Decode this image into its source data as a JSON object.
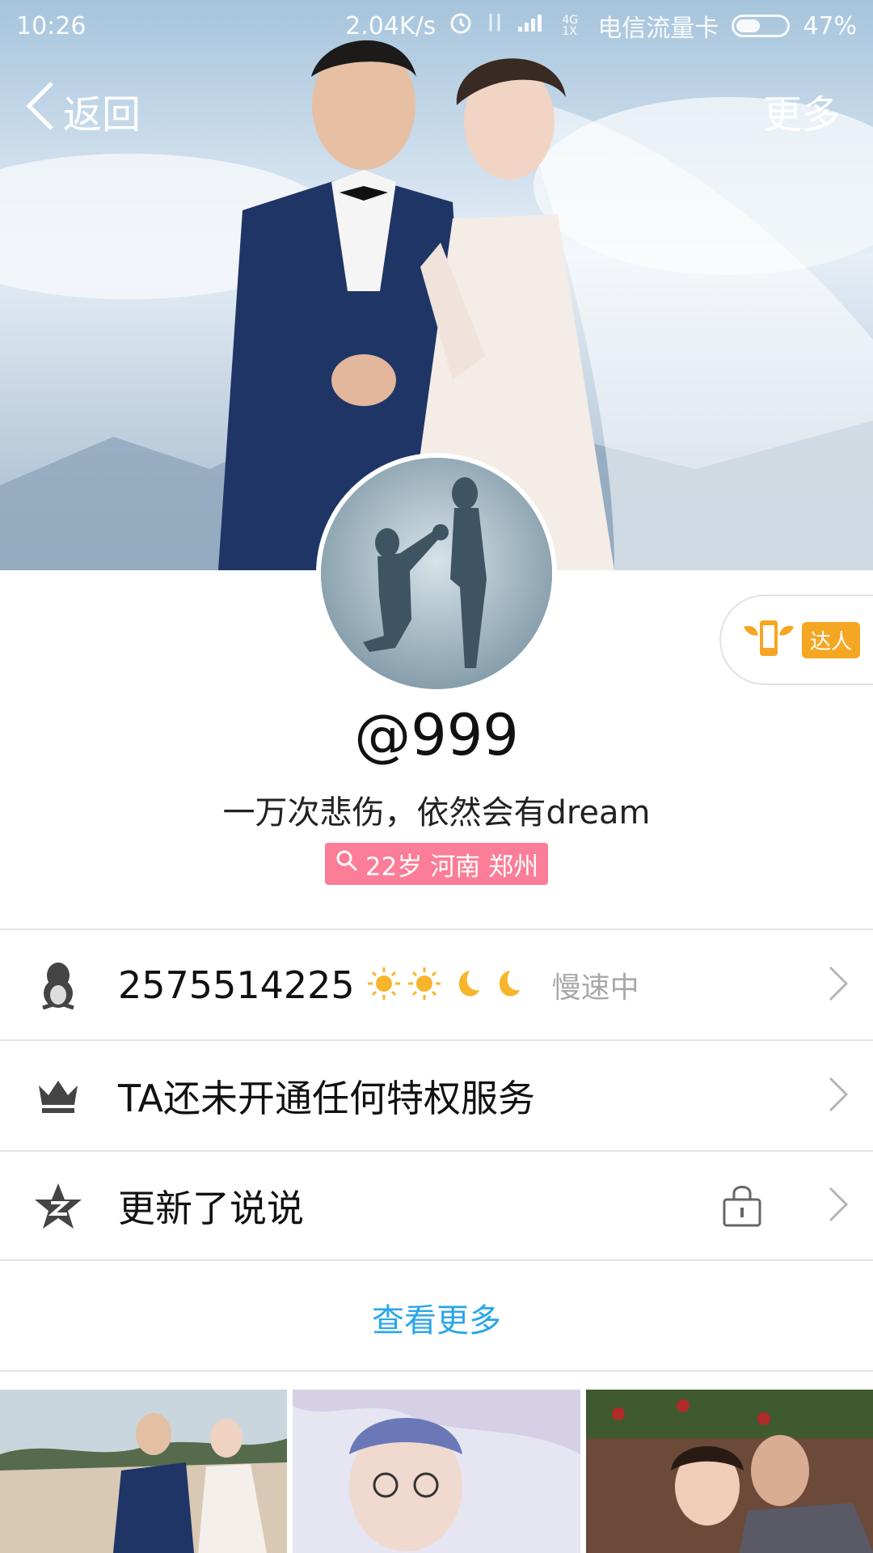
{
  "status_bar": {
    "time": "10:26",
    "net_speed": "2.04K/s",
    "network": "4G 1X",
    "carrier": "电信流量卡",
    "battery": "47%"
  },
  "nav": {
    "back_label": "返回",
    "more_label": "更多"
  },
  "profile": {
    "nickname": "@999",
    "signature": "一万次悲伤，依然会有dream",
    "info_tag": "22岁 河南 郑州",
    "badge_label": "达人"
  },
  "rows": [
    {
      "icon": "penguin-icon",
      "text": "2575514225",
      "level_icons": [
        "sun-icon",
        "sun-icon",
        "moon-icon",
        "moon-icon"
      ],
      "status": "慢速中"
    },
    {
      "icon": "crown-icon",
      "text": "TA还未开通任何特权服务"
    },
    {
      "icon": "qzone-star-icon",
      "text": "更新了说说",
      "extra_icon": "lock-icon"
    }
  ],
  "see_more_label": "查看更多",
  "colors": {
    "tag_pink": "#fb7d98",
    "link_blue": "#29a6e8",
    "badge_orange": "#f5a623"
  }
}
